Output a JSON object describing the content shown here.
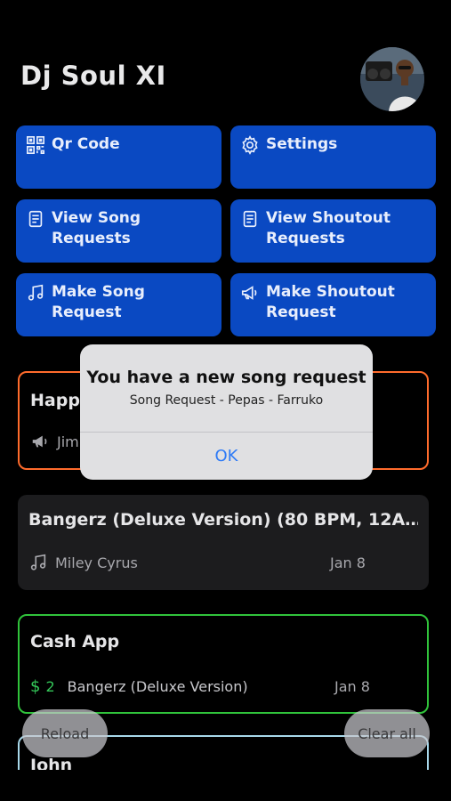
{
  "header": {
    "title": "Dj Soul XI"
  },
  "buttons": {
    "qr": "Qr Code",
    "settings": "Settings",
    "view_song": "View Song Requests",
    "view_shoutout": "View Shoutout Requests",
    "make_song": "Make Song Request",
    "make_shoutout": "Make Shoutout Request"
  },
  "cards": [
    {
      "title": "Happ",
      "name": "Jim",
      "border": "#ff6b2c"
    },
    {
      "title": "Bangerz (Deluxe Version) (80 BPM, 12A…",
      "artist": "Miley Cyrus",
      "date": "Jan 8"
    },
    {
      "title": "Cash App",
      "currency": "$",
      "amount": "2",
      "song": "Bangerz (Deluxe Version)",
      "date": "Jan 8",
      "border": "#30c33b"
    },
    {
      "title": "John",
      "border": "#a8d8ea"
    }
  ],
  "actions": {
    "reload": "Reload",
    "clear_all": "Clear all"
  },
  "alert": {
    "title": "You have a new song request",
    "message": "Song Request - Pepas - Farruko",
    "ok": "OK"
  },
  "colors": {
    "button_blue": "#0a49c2",
    "accent_blue": "#2f7bf6",
    "cash_green": "#34c759"
  }
}
